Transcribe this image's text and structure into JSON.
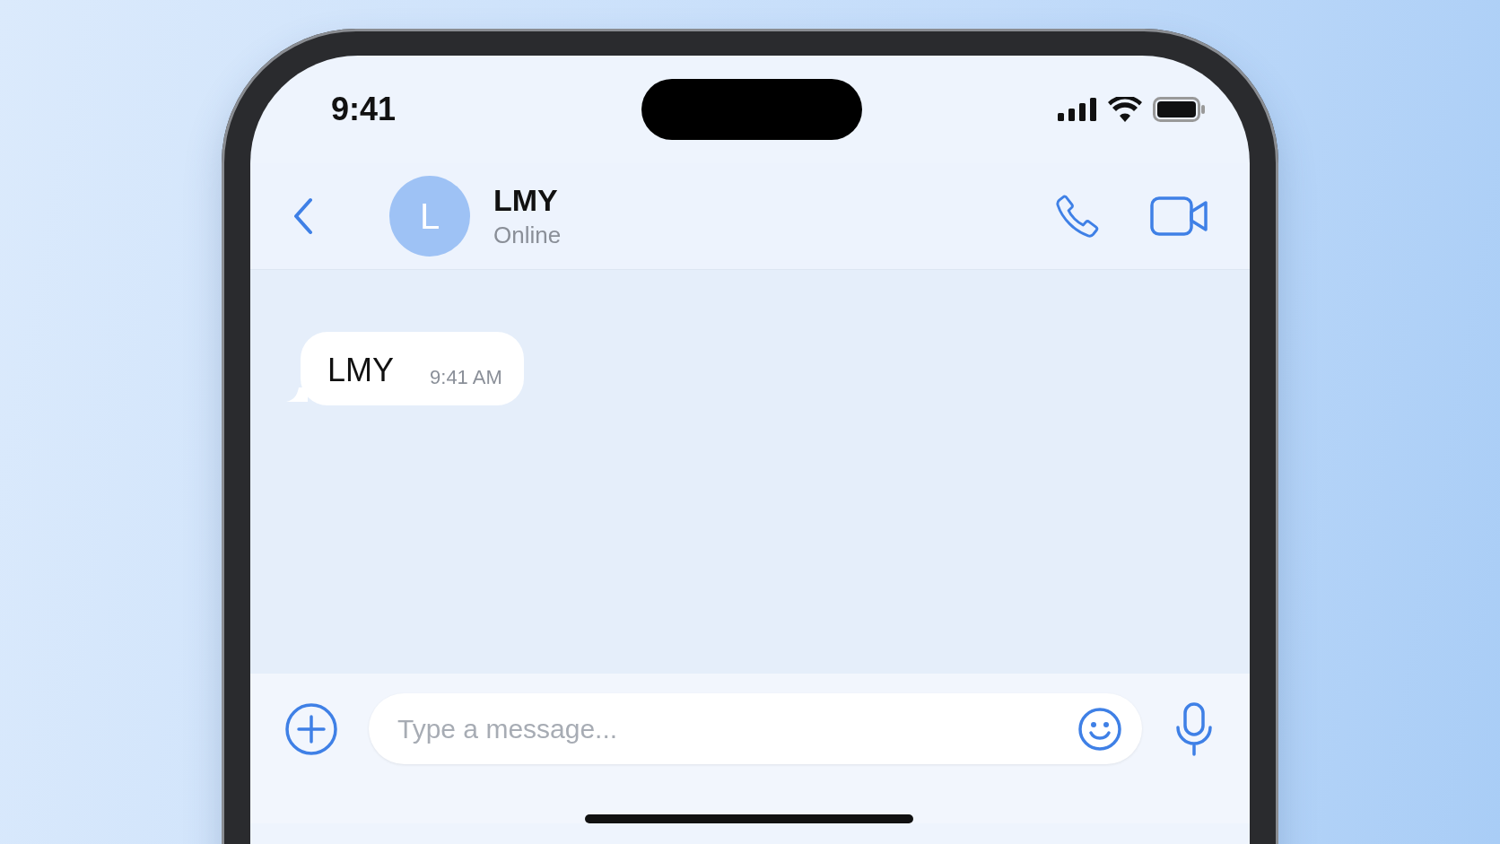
{
  "status_bar": {
    "time": "9:41"
  },
  "header": {
    "avatar_initial": "L",
    "name": "LMY",
    "status": "Online"
  },
  "messages": [
    {
      "kind": "incoming",
      "text": "LMY",
      "time": "9:41 AM"
    }
  ],
  "composer": {
    "placeholder": "Type a message..."
  }
}
